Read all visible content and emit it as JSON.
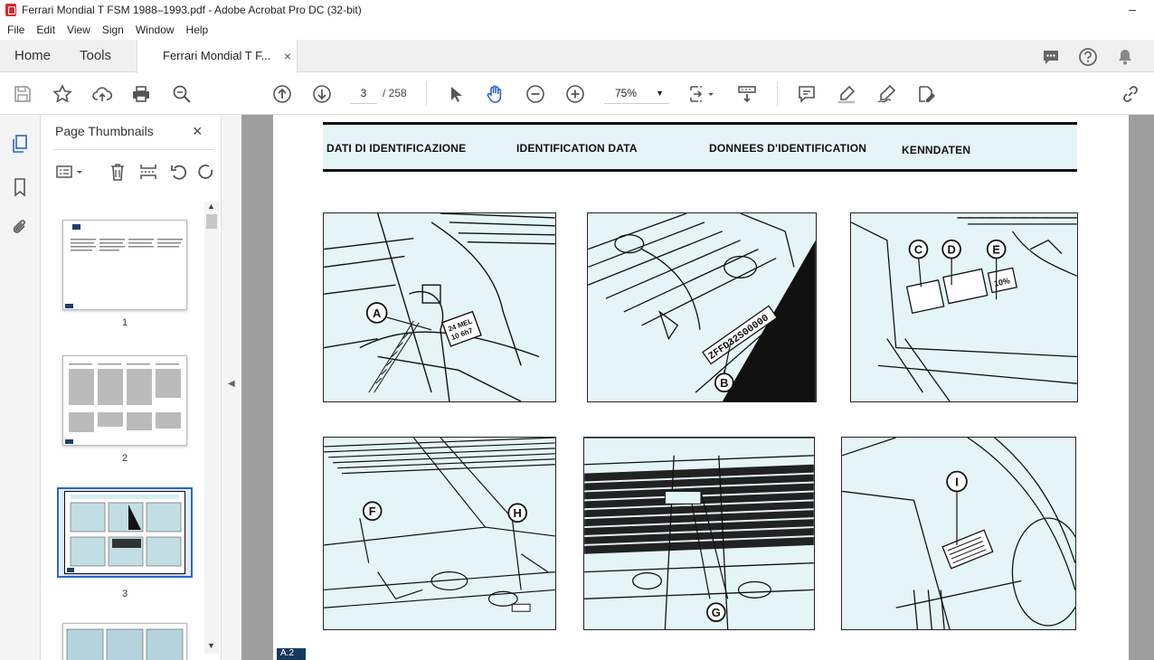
{
  "window": {
    "title": "Ferrari Mondial T FSM 1988–1993.pdf - Adobe Acrobat Pro DC (32-bit)",
    "minimize_glyph": "–"
  },
  "menu": [
    "File",
    "Edit",
    "View",
    "Sign",
    "Window",
    "Help"
  ],
  "tabs": {
    "home": "Home",
    "tools": "Tools",
    "document": "Ferrari Mondial T F...",
    "close_glyph": "×"
  },
  "toolbar": {
    "page_current": "3",
    "page_total": "/ 258",
    "zoom": "75%"
  },
  "sidebar": {
    "panel_title": "Page Thumbnails",
    "thumbnails": [
      {
        "label": "1"
      },
      {
        "label": "2"
      },
      {
        "label": "3"
      }
    ],
    "selected": "3"
  },
  "document": {
    "headings": [
      "DATI DI IDENTIFICAZIONE",
      "IDENTIFICATION DATA",
      "DONNEES D'IDENTIFICATION",
      "KENNDATEN"
    ],
    "callouts": [
      "A",
      "B",
      "C",
      "D",
      "E",
      "F",
      "H",
      "G",
      "I"
    ],
    "plate_text": "ZFFD32S00000",
    "page_marker": "A.2"
  },
  "colors": {
    "accent": "#2a66c9",
    "page_tint": "#e4f4f7",
    "acrobat_red": "#e0262b"
  }
}
